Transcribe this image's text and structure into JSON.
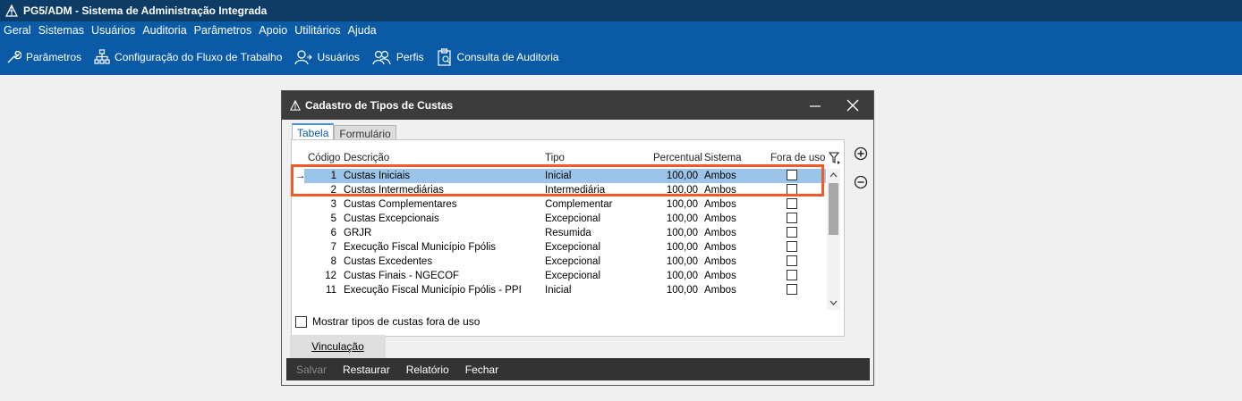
{
  "app": {
    "title": "PG5/ADM - Sistema de Administração Integrada"
  },
  "menu": [
    "Geral",
    "Sistemas",
    "Usuários",
    "Auditoria",
    "Parâmetros",
    "Apoio",
    "Utilitários",
    "Ajuda"
  ],
  "toolbar": [
    {
      "label": "Parâmetros",
      "icon": "wrench-icon"
    },
    {
      "label": "Configuração do Fluxo de Trabalho",
      "icon": "workflow-icon"
    },
    {
      "label": "Usuários",
      "icon": "user-icon"
    },
    {
      "label": "Perfis",
      "icon": "users-icon"
    },
    {
      "label": "Consulta de Auditoria",
      "icon": "clipboard-icon"
    }
  ],
  "dialog": {
    "title": "Cadastro de Tipos de Custas",
    "tabs": [
      "Tabela",
      "Formulário"
    ],
    "columns": {
      "codigo": "Código",
      "descricao": "Descrição",
      "tipo": "Tipo",
      "percentual": "Percentual",
      "sistema": "Sistema",
      "fora_de_uso": "Fora de uso"
    },
    "rows": [
      {
        "codigo": "1",
        "descricao": "Custas Iniciais",
        "tipo": "Inicial",
        "percentual": "100,00",
        "sistema": "Ambos",
        "fora_de_uso": false,
        "selected": true
      },
      {
        "codigo": "2",
        "descricao": "Custas Intermediárias",
        "tipo": "Intermediária",
        "percentual": "100,00",
        "sistema": "Ambos",
        "fora_de_uso": false
      },
      {
        "codigo": "3",
        "descricao": "Custas Complementares",
        "tipo": "Complementar",
        "percentual": "100,00",
        "sistema": "Ambos",
        "fora_de_uso": false
      },
      {
        "codigo": "5",
        "descricao": "Custas Excepcionais",
        "tipo": "Excepcional",
        "percentual": "100,00",
        "sistema": "Ambos",
        "fora_de_uso": false
      },
      {
        "codigo": "6",
        "descricao": "GRJR",
        "tipo": "Resumida",
        "percentual": "100,00",
        "sistema": "Ambos",
        "fora_de_uso": false
      },
      {
        "codigo": "7",
        "descricao": "Execução Fiscal Município Fpólis",
        "tipo": "Excepcional",
        "percentual": "100,00",
        "sistema": "Ambos",
        "fora_de_uso": false
      },
      {
        "codigo": "8",
        "descricao": "Custas Excedentes",
        "tipo": "Excepcional",
        "percentual": "100,00",
        "sistema": "Ambos",
        "fora_de_uso": false
      },
      {
        "codigo": "12",
        "descricao": "Custas Finais - NGECOF",
        "tipo": "Excepcional",
        "percentual": "100,00",
        "sistema": "Ambos",
        "fora_de_uso": false
      },
      {
        "codigo": "11",
        "descricao": "Execução Fiscal Município Fpólis - PPI",
        "tipo": "Inicial",
        "percentual": "100,00",
        "sistema": "Ambos",
        "fora_de_uso": false
      }
    ],
    "show_unused_label": "Mostrar tipos de custas fora de uso",
    "vinculacao_label": "Vinculação",
    "actions": {
      "salvar": "Salvar",
      "restaurar": "Restaurar",
      "relatorio": "Relatório",
      "fechar": "Fechar"
    },
    "highlight_color": "#f05a28"
  }
}
